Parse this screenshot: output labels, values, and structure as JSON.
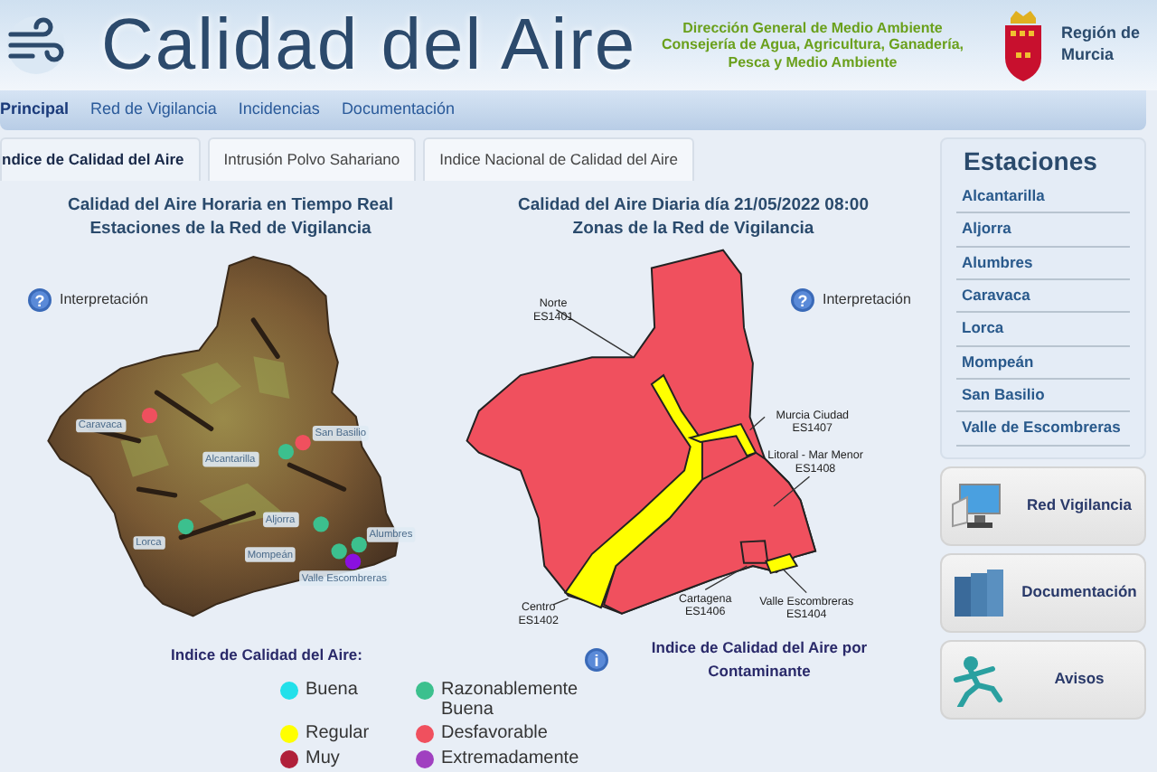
{
  "header": {
    "title": "Calidad del Aire",
    "agency": "Dirección General de Medio Ambiente",
    "ministry": "Consejería de Agua, Agricultura, Ganadería, Pesca y Medio Ambiente",
    "region": "Región de Murcia"
  },
  "nav": [
    {
      "label": "Principal",
      "selected": true
    },
    {
      "label": "Red de Vigilancia",
      "selected": false
    },
    {
      "label": "Incidencias",
      "selected": false
    },
    {
      "label": "Documentación",
      "selected": false
    }
  ],
  "tabs": [
    {
      "label": "ndice de Calidad del Aire",
      "selected": true
    },
    {
      "label": "Intrusión Polvo Sahariano",
      "selected": false
    },
    {
      "label": "Indice Nacional de Calidad del Aire",
      "selected": false
    }
  ],
  "icons": {
    "help": "?",
    "info": "i"
  },
  "hourly": {
    "title": "Calidad del Aire Horaria en Tiempo Real",
    "subtitle": "Estaciones de la Red de Vigilancia",
    "help": "Interpretación",
    "stations": [
      {
        "name": "Caravaca",
        "color": "#f0505e"
      },
      {
        "name": "San Basilio",
        "color": "#f0505e"
      },
      {
        "name": "Alcantarilla",
        "color": "#3cc08e"
      },
      {
        "name": "Lorca",
        "color": "#3cc08e"
      },
      {
        "name": "Aljorra",
        "color": "#3cc08e"
      },
      {
        "name": "Alumbres",
        "color": "#3cc08e"
      },
      {
        "name": "Mompeán",
        "color": "#3cc08e"
      },
      {
        "name": "Valle Escombreras",
        "color": "#8a10e0"
      }
    ]
  },
  "daily": {
    "title": "Calidad del Aire Diaria día 21/05/2022 08:00",
    "subtitle": "Zonas de la Red de Vigilancia",
    "help": "Interpretación",
    "zones": [
      {
        "name": "Norte",
        "code": "ES1401",
        "color": "#f0505e"
      },
      {
        "name": "Litoral - Mar Menor",
        "code": "ES1408",
        "color": "#f0505e"
      },
      {
        "name": "Centro",
        "code": "ES1402",
        "color": "#ffff00"
      },
      {
        "name": "Murcia Ciudad",
        "code": "ES1407",
        "color": "#ffff00"
      },
      {
        "name": "Cartagena",
        "code": "ES1406",
        "color": "#f0505e"
      },
      {
        "name": "Valle Escombreras",
        "code": "ES1404",
        "color": "#ffff00"
      }
    ],
    "pollutant_link": "Indice de Calidad del Aire por Contaminante"
  },
  "legend": {
    "title": "Indice de Calidad del Aire:",
    "levels": [
      {
        "label": "Buena",
        "color": "#22e0ea"
      },
      {
        "label": "Razonablemente Buena",
        "color": "#3cc08e"
      },
      {
        "label": "Regular",
        "color": "#ffff00"
      },
      {
        "label": "Desfavorable",
        "color": "#f0505e"
      },
      {
        "label": "Muy",
        "color": "#b0203a"
      },
      {
        "label": "Extremadamente",
        "color": "#a040c0"
      }
    ]
  },
  "sidebar": {
    "title": "Estaciones",
    "stations": [
      "Alcantarilla",
      "Aljorra",
      "Alumbres",
      "Caravaca",
      "Lorca",
      "Mompeán",
      "San Basilio",
      "Valle de Escombreras"
    ],
    "links": [
      {
        "label": "Red Vigilancia",
        "kind": "monitor"
      },
      {
        "label": "Documentación",
        "kind": "binders"
      },
      {
        "label": "Avisos",
        "kind": "figure"
      }
    ]
  }
}
